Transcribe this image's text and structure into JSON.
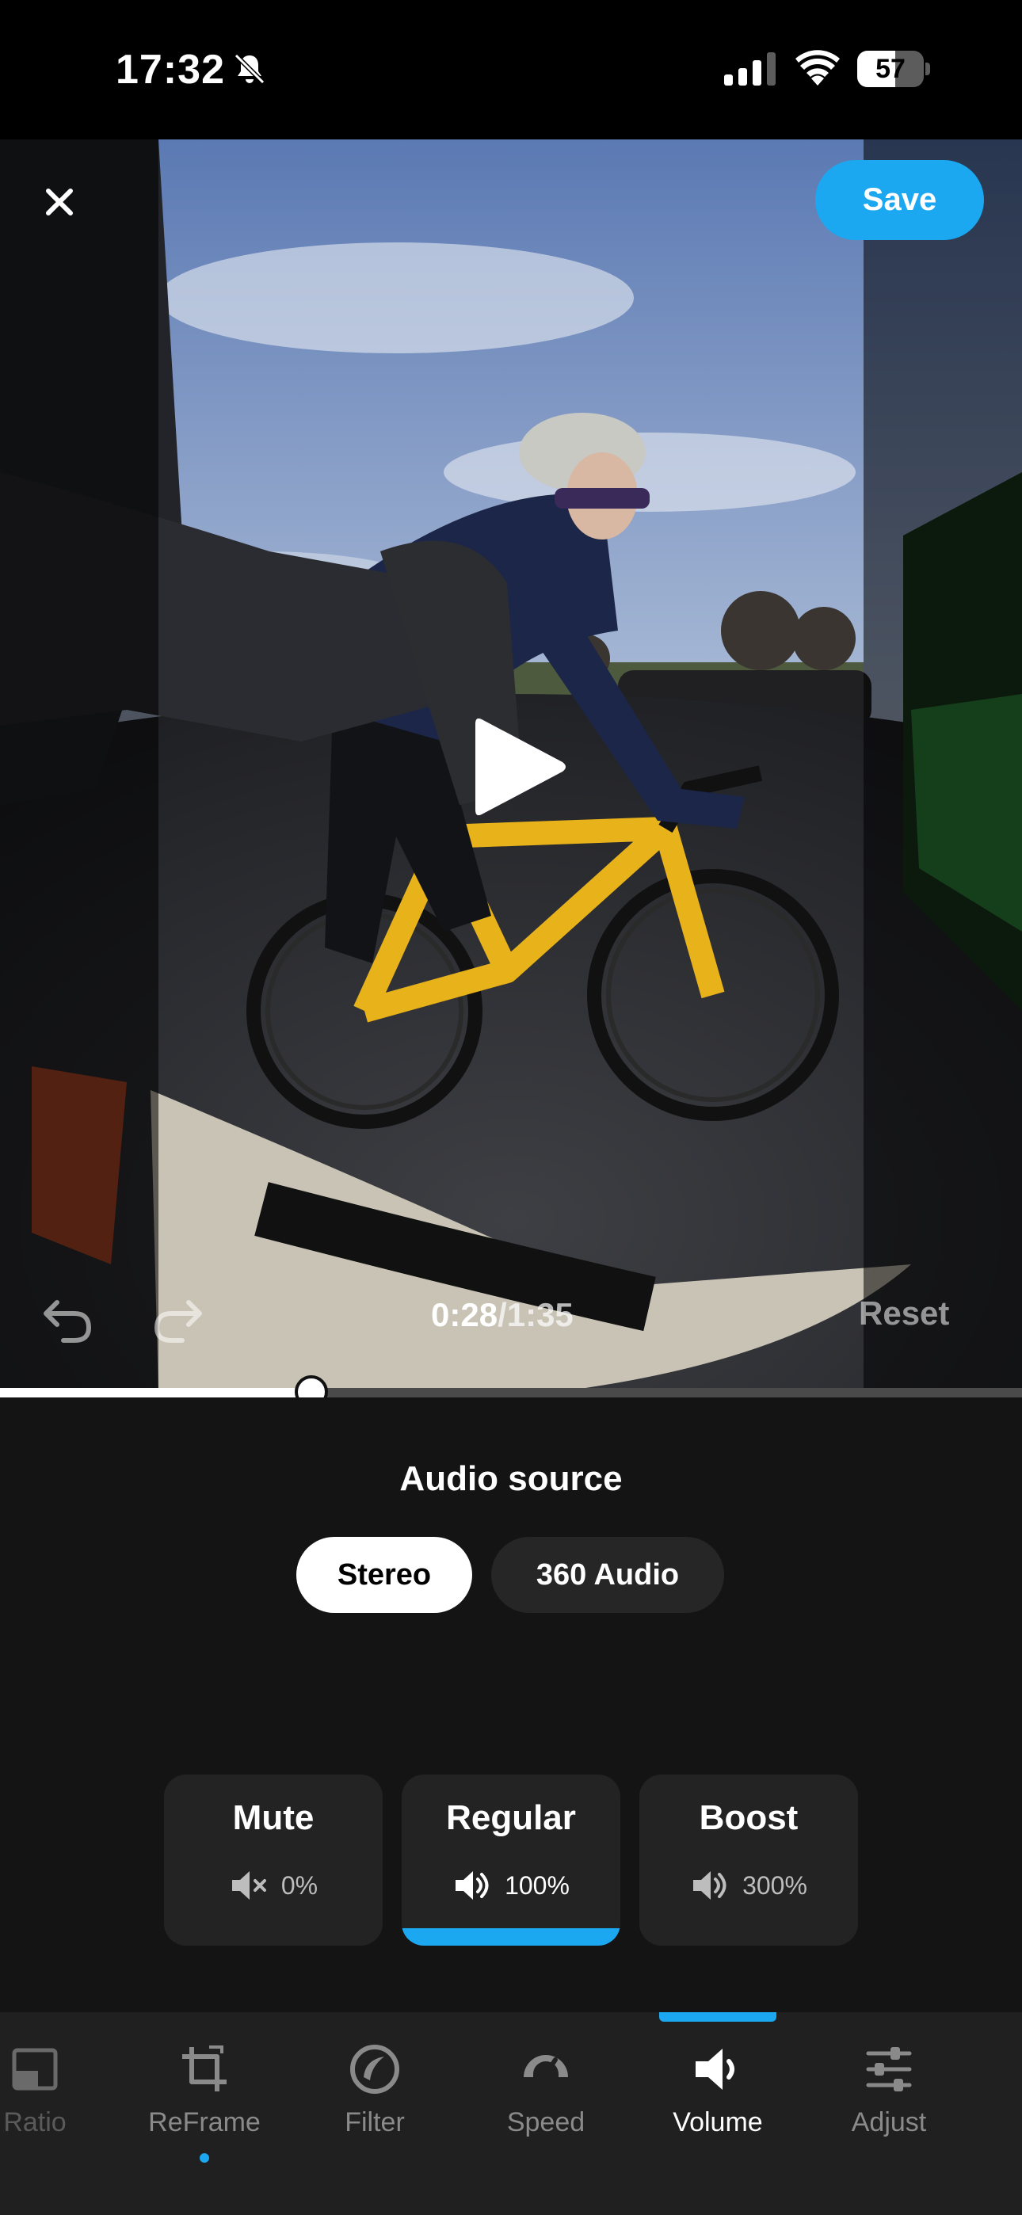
{
  "status_bar": {
    "time": "17:32",
    "battery_percent": "57",
    "battery_level": 0.57,
    "icons": [
      "bell-slash-icon",
      "cellular-signal-icon",
      "wifi-icon",
      "battery-icon"
    ]
  },
  "editor": {
    "save_label": "Save",
    "close_icon": "close-icon",
    "play_icon": "play-icon",
    "undo_icon": "undo-icon",
    "redo_icon": "redo-icon",
    "time_current": "0:28",
    "time_total": "/1:35",
    "reset_label": "Reset",
    "playback_progress": 0.305
  },
  "audio": {
    "title": "Audio source",
    "sources": [
      {
        "label": "Stereo",
        "selected": true
      },
      {
        "label": "360 Audio",
        "selected": false
      }
    ],
    "levels": [
      {
        "label": "Mute",
        "value": "0%",
        "icon": "speaker-mute-icon",
        "selected": false
      },
      {
        "label": "Regular",
        "value": "100%",
        "icon": "speaker-icon",
        "selected": true
      },
      {
        "label": "Boost",
        "value": "300%",
        "icon": "speaker-boost-icon",
        "selected": false
      }
    ]
  },
  "tabs": [
    {
      "label": "Ratio",
      "icon": "ratio-icon",
      "active": false
    },
    {
      "label": "ReFrame",
      "icon": "reframe-icon",
      "active": false,
      "dot": true
    },
    {
      "label": "Filter",
      "icon": "filter-icon",
      "active": false
    },
    {
      "label": "Speed",
      "icon": "speedometer-icon",
      "active": false
    },
    {
      "label": "Volume",
      "icon": "speaker-icon",
      "active": true
    },
    {
      "label": "Adjust",
      "icon": "sliders-icon",
      "active": false
    }
  ],
  "colors": {
    "accent": "#1ba8f0",
    "background": "#141414",
    "tabbar": "#202020"
  }
}
